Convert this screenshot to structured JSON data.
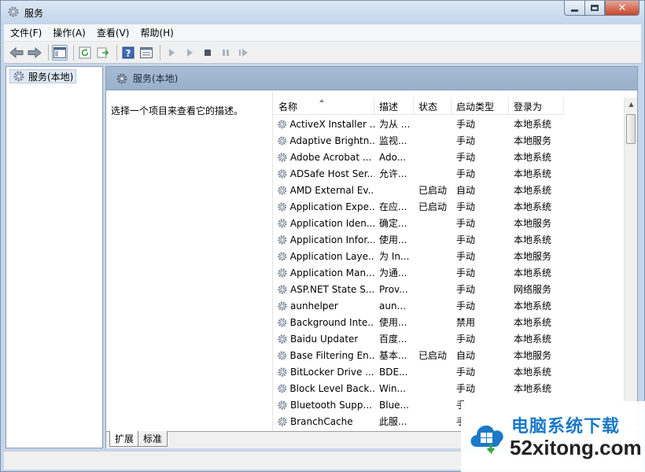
{
  "window": {
    "title": "服务"
  },
  "menu": [
    "文件(F)",
    "操作(A)",
    "查看(V)",
    "帮助(H)"
  ],
  "toolbar": [
    "back-icon",
    "forward-icon",
    "console-tree-icon",
    "refresh-icon",
    "export-icon",
    "help-icon",
    "properties-icon",
    "start-icon",
    "start-alt-icon",
    "stop-icon",
    "pause-icon",
    "resume-icon"
  ],
  "tree": {
    "root": "服务(本地)"
  },
  "pane": {
    "header": "服务(本地)",
    "description": "选择一个项目来查看它的描述。"
  },
  "columns": {
    "name": "名称",
    "desc": "描述",
    "status": "状态",
    "start": "启动类型",
    "logon": "登录为"
  },
  "services": [
    {
      "name": "ActiveX Installer ...",
      "desc": "为从 ...",
      "status": "",
      "start": "手动",
      "logon": "本地系统"
    },
    {
      "name": "Adaptive Brightn...",
      "desc": "监视...",
      "status": "",
      "start": "手动",
      "logon": "本地服务"
    },
    {
      "name": "Adobe Acrobat ...",
      "desc": "Ado...",
      "status": "",
      "start": "手动",
      "logon": "本地系统"
    },
    {
      "name": "ADSafe Host Ser...",
      "desc": "允许...",
      "status": "",
      "start": "手动",
      "logon": "本地系统"
    },
    {
      "name": "AMD External Ev...",
      "desc": "",
      "status": "已启动",
      "start": "自动",
      "logon": "本地系统"
    },
    {
      "name": "Application Expe...",
      "desc": "在应...",
      "status": "已启动",
      "start": "手动",
      "logon": "本地系统"
    },
    {
      "name": "Application Iden...",
      "desc": "确定...",
      "status": "",
      "start": "手动",
      "logon": "本地服务"
    },
    {
      "name": "Application Infor...",
      "desc": "使用...",
      "status": "",
      "start": "手动",
      "logon": "本地系统"
    },
    {
      "name": "Application Laye...",
      "desc": "为 In...",
      "status": "",
      "start": "手动",
      "logon": "本地服务"
    },
    {
      "name": "Application Man...",
      "desc": "为通...",
      "status": "",
      "start": "手动",
      "logon": "本地系统"
    },
    {
      "name": "ASP.NET State S...",
      "desc": "Prov...",
      "status": "",
      "start": "手动",
      "logon": "网络服务"
    },
    {
      "name": "aunhelper",
      "desc": "aun...",
      "status": "",
      "start": "手动",
      "logon": "本地系统"
    },
    {
      "name": "Background Inte...",
      "desc": "使用...",
      "status": "",
      "start": "禁用",
      "logon": "本地系统"
    },
    {
      "name": "Baidu Updater",
      "desc": "百度...",
      "status": "",
      "start": "手动",
      "logon": "本地系统"
    },
    {
      "name": "Base Filtering En...",
      "desc": "基本...",
      "status": "已启动",
      "start": "自动",
      "logon": "本地服务"
    },
    {
      "name": "BitLocker Drive ...",
      "desc": "BDE...",
      "status": "",
      "start": "手动",
      "logon": "本地系统"
    },
    {
      "name": "Block Level Back...",
      "desc": "Win...",
      "status": "",
      "start": "手动",
      "logon": "本地系统"
    },
    {
      "name": "Bluetooth Supp...",
      "desc": "Blue...",
      "status": "",
      "start": "手",
      "logon": ""
    },
    {
      "name": "BranchCache",
      "desc": "此服...",
      "status": "",
      "start": "手",
      "logon": ""
    }
  ],
  "tabs": [
    "扩展",
    "标准"
  ],
  "watermark": {
    "cn": "电脑系统下载",
    "en": "52xitong.com"
  }
}
